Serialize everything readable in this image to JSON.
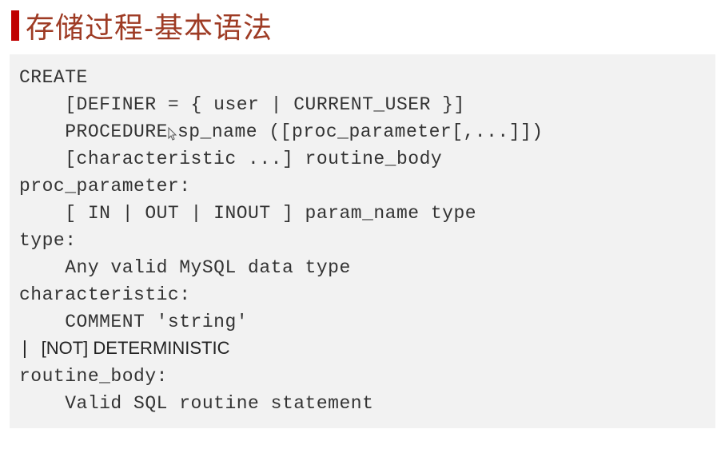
{
  "title": "存储过程-基本语法",
  "code": {
    "line1": "CREATE",
    "line2": "    [DEFINER = { user | CURRENT_USER }]",
    "line3a": "    PROCEDURE",
    "line3b": "sp_name ([proc_parameter[,...]])",
    "line4": "    [characteristic ...] routine_body",
    "line5": "",
    "line6": "proc_parameter:",
    "line7": "    [ IN | OUT | INOUT ] param_name type",
    "line8": "type:",
    "line9": "    Any valid MySQL data type",
    "line10": "characteristic:",
    "line11": "    COMMENT 'string'",
    "line12_pipe": "  | ",
    "line12_text": "[NOT] DETERMINISTIC",
    "line13": "routine_body:",
    "line14": "    Valid SQL routine statement"
  }
}
